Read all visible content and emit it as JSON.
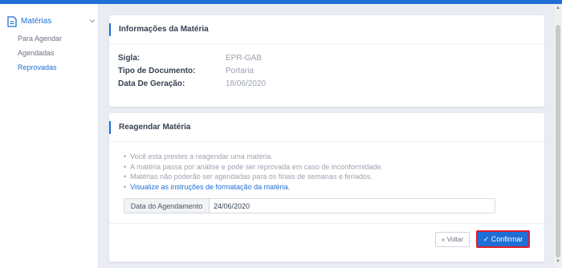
{
  "sidebar": {
    "section_label": "Matérias",
    "items": [
      {
        "label": "Para Agendar"
      },
      {
        "label": "Agendadas"
      },
      {
        "label": "Reprovadas",
        "active": true
      }
    ]
  },
  "info_card": {
    "title": "Informações da Matéria",
    "rows": [
      {
        "key": "Sigla:",
        "value": "EPR-GAB"
      },
      {
        "key": "Tipo de Documento:",
        "value": "Portaria"
      },
      {
        "key": "Data De Geração:",
        "value": "18/06/2020"
      }
    ]
  },
  "reschedule_card": {
    "title": "Reagendar Matéria",
    "bullets": [
      "Você esta prestes a reagendar uma matéria.",
      "A matéria passa por análise e pode ser reprovada em caso de inconformidade.",
      "Matérias não poderão ser agendadas para os finais de semanas e feriados."
    ],
    "instructions_link": "Visualize as instruções de formatação da matéria.",
    "date_label": "Data do Agendamento",
    "date_value": "24/06/2020",
    "back_button": "« Voltar",
    "confirm_button": "✓ Confirmar"
  },
  "colors": {
    "accent": "#1f6fd6",
    "highlight_border": "#e11d2a",
    "background": "#e9ecf2"
  },
  "icons": {
    "sidebar_section": "document-icon",
    "sidebar_toggle": "chevron-down-icon"
  }
}
